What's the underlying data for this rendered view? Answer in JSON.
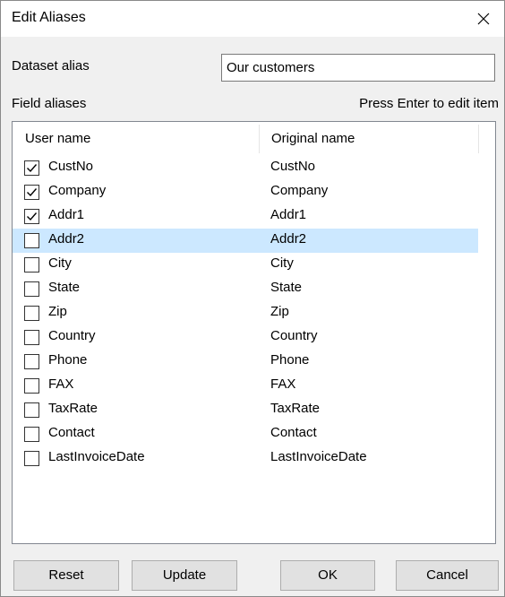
{
  "window": {
    "title": "Edit Aliases"
  },
  "dataset": {
    "label": "Dataset alias",
    "value": "Our customers"
  },
  "fields": {
    "label": "Field aliases",
    "hint": "Press Enter to edit item",
    "columns": [
      "User name",
      "Original name"
    ],
    "rows": [
      {
        "user": "CustNo",
        "original": "CustNo",
        "checked": true
      },
      {
        "user": "Company",
        "original": "Company",
        "checked": true
      },
      {
        "user": "Addr1",
        "original": "Addr1",
        "checked": true
      },
      {
        "user": "Addr2",
        "original": "Addr2",
        "checked": false,
        "selected": true
      },
      {
        "user": "City",
        "original": "City",
        "checked": false
      },
      {
        "user": "State",
        "original": "State",
        "checked": false
      },
      {
        "user": "Zip",
        "original": "Zip",
        "checked": false
      },
      {
        "user": "Country",
        "original": "Country",
        "checked": false
      },
      {
        "user": "Phone",
        "original": "Phone",
        "checked": false
      },
      {
        "user": "FAX",
        "original": "FAX",
        "checked": false
      },
      {
        "user": "TaxRate",
        "original": "TaxRate",
        "checked": false
      },
      {
        "user": "Contact",
        "original": "Contact",
        "checked": false
      },
      {
        "user": "LastInvoiceDate",
        "original": "LastInvoiceDate",
        "checked": false
      }
    ]
  },
  "buttons": {
    "reset": "Reset",
    "update": "Update",
    "ok": "OK",
    "cancel": "Cancel"
  },
  "colors": {
    "selection": "#cce8ff",
    "dialog_bg": "#f0f0f0",
    "border": "#828790"
  }
}
